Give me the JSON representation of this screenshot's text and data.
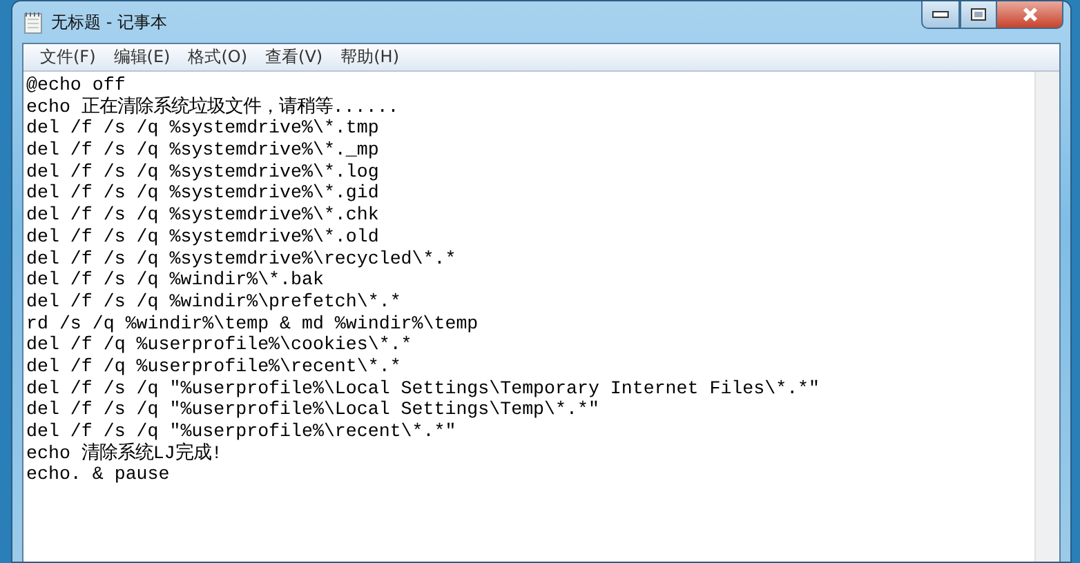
{
  "window": {
    "title": "无标题 - 记事本"
  },
  "menu": [
    "文件(F)",
    "编辑(E)",
    "格式(O)",
    "查看(V)",
    "帮助(H)"
  ],
  "lines": [
    "@echo off",
    "echo 正在清除系统垃圾文件，请稍等......",
    "del /f /s /q %systemdrive%\\*.tmp",
    "del /f /s /q %systemdrive%\\*._mp",
    "del /f /s /q %systemdrive%\\*.log",
    "del /f /s /q %systemdrive%\\*.gid",
    "del /f /s /q %systemdrive%\\*.chk",
    "del /f /s /q %systemdrive%\\*.old",
    "del /f /s /q %systemdrive%\\recycled\\*.*",
    "del /f /s /q %windir%\\*.bak",
    "del /f /s /q %windir%\\prefetch\\*.*",
    "rd /s /q %windir%\\temp & md %windir%\\temp",
    "del /f /q %userprofile%\\cookies\\*.*",
    "del /f /q %userprofile%\\recent\\*.*",
    "del /f /s /q \"%userprofile%\\Local Settings\\Temporary Internet Files\\*.*\"",
    "del /f /s /q \"%userprofile%\\Local Settings\\Temp\\*.*\"",
    "del /f /s /q \"%userprofile%\\recent\\*.*\"",
    "echo 清除系统LJ完成!",
    "echo. & pause"
  ]
}
